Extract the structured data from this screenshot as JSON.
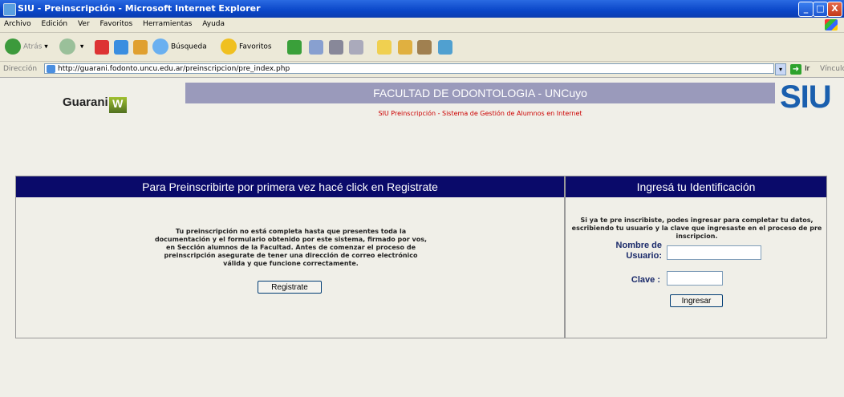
{
  "window": {
    "title": "SIU - Preinscripción - Microsoft Internet Explorer",
    "min": "_",
    "max": "□",
    "close": "X"
  },
  "menu": [
    "Archivo",
    "Edición",
    "Ver",
    "Favoritos",
    "Herramientas",
    "Ayuda"
  ],
  "toolbar": {
    "back": "Atrás",
    "search": "Búsqueda",
    "favorites": "Favoritos"
  },
  "address": {
    "label": "Dirección",
    "url": "http://guarani.fodonto.uncu.edu.ar/preinscripcion/pre_index.php",
    "go": "Ir",
    "links": "Vínculos"
  },
  "header": {
    "logo_left": "Guarani",
    "logo_left_mark": "W",
    "title": "FACULTAD DE ODONTOLOGIA - UNCuyo",
    "subtitle": "SIU Preinscripción - Sistema de Gestión de Alumnos en Internet",
    "logo_right": "SIU"
  },
  "register_panel": {
    "heading": "Para Preinscribirte por primera vez hacé click en Registrate",
    "info": "Tu preinscripción no está completa hasta que presentes toda la documentación y el formulario obtenido por este sistema, firmado por vos, en Sección alumnos de la Facultad. Antes de comenzar el proceso de preinscripción asegurate de tener una dirección de correo electrónico válida y que funcione correctamente.",
    "button": "Registrate"
  },
  "login_panel": {
    "heading": "Ingresá tu Identificación",
    "info": "Si ya te pre inscribiste, podes ingresar para completar tu datos, escribiendo tu usuario y la clave que ingresaste en el proceso de pre inscripcion.",
    "user_label": "Nombre de Usuario:",
    "password_label": "Clave :",
    "button": "Ingresar"
  },
  "colors": {
    "panel_header": "#0a0a6a",
    "band": "#9a9abb",
    "subtitle": "#cc0000",
    "siu": "#1a5fae"
  }
}
